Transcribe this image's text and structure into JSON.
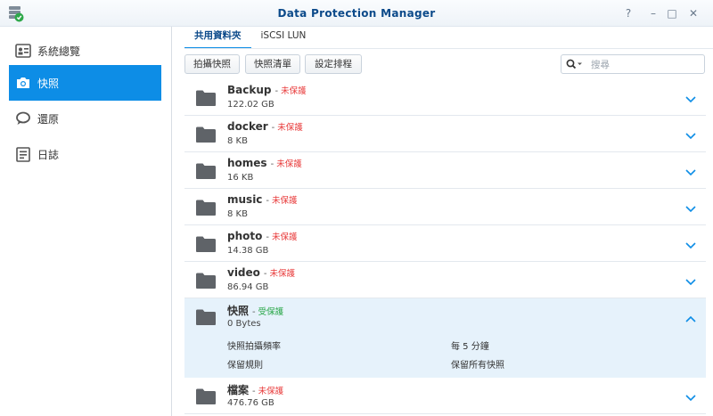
{
  "window": {
    "title": "Data Protection Manager",
    "help_glyph": "?",
    "minimize_glyph": "–",
    "maximize_glyph": "□",
    "close_glyph": "✕"
  },
  "sidebar": {
    "items": [
      {
        "label": "系統總覽",
        "icon": "overview-icon",
        "active": false
      },
      {
        "label": "快照",
        "icon": "camera-icon",
        "active": true
      },
      {
        "label": "還原",
        "icon": "restore-icon",
        "active": false
      },
      {
        "label": "日誌",
        "icon": "log-icon",
        "active": false
      }
    ]
  },
  "tabs": [
    {
      "label": "共用資料夾",
      "active": true
    },
    {
      "label": "iSCSI LUN",
      "active": false
    }
  ],
  "toolbar": {
    "take_snapshot": "拍攝快照",
    "snapshot_list": "快照清單",
    "set_schedule": "設定排程",
    "search_placeholder": "搜尋"
  },
  "folders": [
    {
      "name": "Backup",
      "status": "未保護",
      "protected": false,
      "size": "122.02 GB"
    },
    {
      "name": "docker",
      "status": "未保護",
      "protected": false,
      "size": "8 KB"
    },
    {
      "name": "homes",
      "status": "未保護",
      "protected": false,
      "size": "16 KB"
    },
    {
      "name": "music",
      "status": "未保護",
      "protected": false,
      "size": "8 KB"
    },
    {
      "name": "photo",
      "status": "未保護",
      "protected": false,
      "size": "14.38 GB"
    },
    {
      "name": "video",
      "status": "未保護",
      "protected": false,
      "size": "86.94 GB"
    },
    {
      "name": "快照",
      "status": "受保護",
      "protected": true,
      "size": "0 Bytes",
      "details": [
        {
          "label": "快照拍攝頻率",
          "value": "每 5 分鐘"
        },
        {
          "label": "保留規則",
          "value": "保留所有快照"
        }
      ]
    },
    {
      "name": "檔案",
      "status": "未保護",
      "protected": false,
      "size": "476.76 GB"
    }
  ],
  "separator": "-",
  "colors": {
    "accent": "#0d8de6",
    "title": "#0c4a8a",
    "unprotected": "#e83b3b",
    "protected": "#27a646",
    "folder_icon": "#5f6368",
    "expanded_row": "#e6f2fb"
  }
}
